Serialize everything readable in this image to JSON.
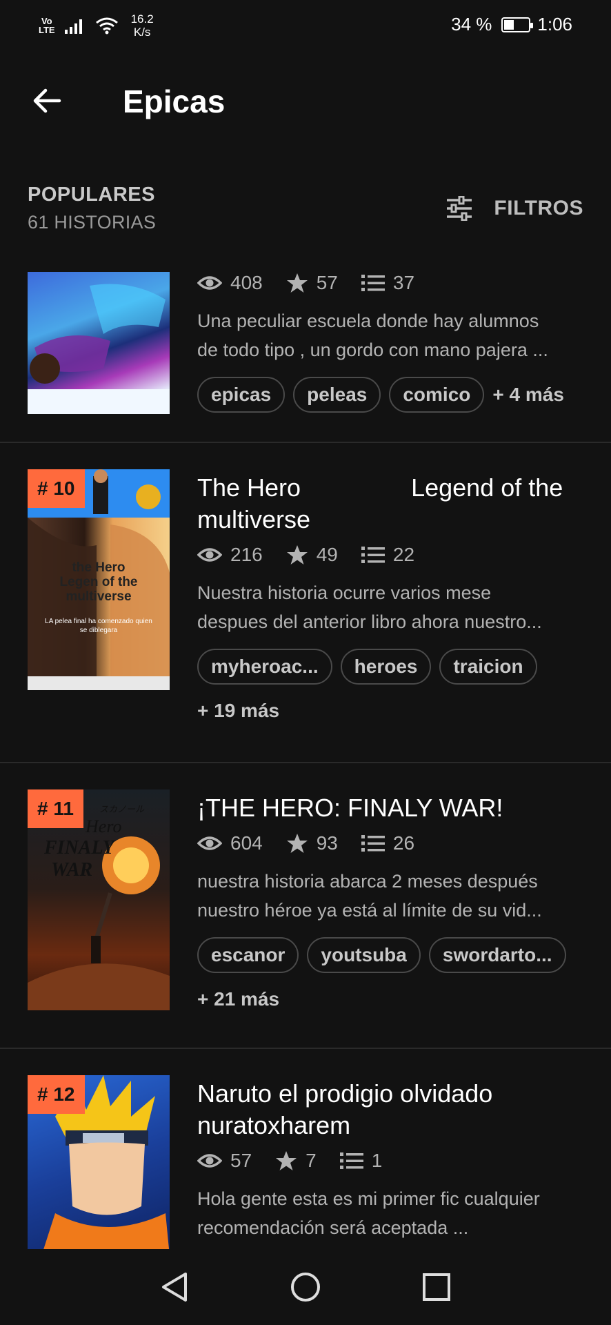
{
  "status_bar": {
    "volte": "Vo\nLTE",
    "net_speed_value": "16.2",
    "net_speed_unit": "K/s",
    "battery": "34 %",
    "time": "1:06"
  },
  "app_bar": {
    "title": "Epicas"
  },
  "section": {
    "title": "POPULARES",
    "count": "61 HISTORIAS",
    "filter_label": "FILTROS"
  },
  "stories": [
    {
      "rank": "",
      "title": "",
      "views": "408",
      "stars": "57",
      "parts": "37",
      "desc_line1": "Una peculiar escuela donde hay alumnos",
      "desc_line2": "de todo tipo , un gordo con mano pajera ...",
      "tags": [
        "epicas",
        "peleas",
        "comico"
      ],
      "more": "+ 4 más"
    },
    {
      "rank": "# 10",
      "title": "The Hero                Legend of the multiverse",
      "views": "216",
      "stars": "49",
      "parts": "22",
      "desc_line1": "Nuestra historia ocurre varios mese",
      "desc_line2": "despues del anterior libro ahora nuestro...",
      "tags": [
        "myheroac...",
        "heroes",
        "traicion"
      ],
      "more": "+ 19 más",
      "cover_text": [
        "the Hero",
        "Legen of the",
        "multiverse",
        "LA pelea final ha comenzado quien",
        "se diblegara"
      ]
    },
    {
      "rank": "# 11",
      "title": "¡THE HERO: FINALY WAR!",
      "views": "604",
      "stars": "93",
      "parts": "26",
      "desc_line1": "nuestra historia abarca 2 meses después",
      "desc_line2": "nuestro héroe ya está al límite de su vid...",
      "tags": [
        "escanor",
        "youtsuba",
        "swordarto..."
      ],
      "more": "+ 21 más",
      "cover_text": [
        "スカノール",
        "Hero",
        "FINALY",
        "WAR"
      ]
    },
    {
      "rank": "# 12",
      "title": "Naruto el prodigio olvidado nuratoxharem",
      "views": "57",
      "stars": "7",
      "parts": "1",
      "desc_line1": "Hola gente esta es mi primer fic cualquier",
      "desc_line2": "recomendación será aceptada ..."
    }
  ],
  "colors": {
    "background": "#121212",
    "rank_badge": "#ff6a3d",
    "text_secondary": "#b3b3b3"
  },
  "icons": {
    "views": "eye-icon",
    "stars": "star-icon",
    "parts": "list-icon",
    "filter": "sliders-icon",
    "back": "arrow-left-icon"
  }
}
